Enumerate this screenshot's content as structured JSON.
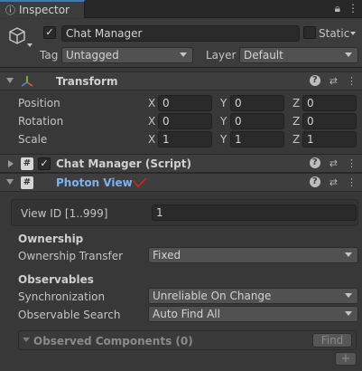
{
  "tab": {
    "title": "Inspector"
  },
  "gameobject": {
    "name": "Chat Manager",
    "static_label": "Static",
    "tag_label": "Tag",
    "tag_value": "Untagged",
    "layer_label": "Layer",
    "layer_value": "Default"
  },
  "transform": {
    "title": "Transform",
    "rows": [
      {
        "label": "Position",
        "x": "0",
        "y": "0",
        "z": "0"
      },
      {
        "label": "Rotation",
        "x": "0",
        "y": "0",
        "z": "0"
      },
      {
        "label": "Scale",
        "x": "1",
        "y": "1",
        "z": "1"
      }
    ],
    "axes": {
      "x": "X",
      "y": "Y",
      "z": "Z"
    }
  },
  "script": {
    "title": "Chat Manager (Script)"
  },
  "photon": {
    "title": "Photon View",
    "view_id_label": "View ID [1..999]",
    "view_id_value": "1",
    "ownership_header": "Ownership",
    "ownership_transfer_label": "Ownership Transfer",
    "ownership_transfer_value": "Fixed",
    "observables_header": "Observables",
    "sync_label": "Synchronization",
    "sync_value": "Unreliable On Change",
    "search_label": "Observable Search",
    "search_value": "Auto Find All",
    "observed_label": "Observed Components (0)",
    "find_label": "Find",
    "add_label": "+"
  },
  "colors": {
    "accent": "#3a79bb",
    "photon_title": "#7fb2ea",
    "annotation": "#e02020"
  }
}
